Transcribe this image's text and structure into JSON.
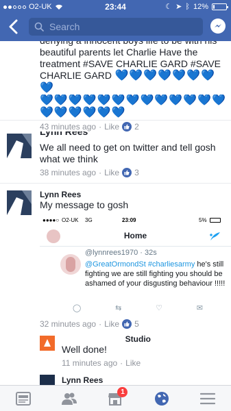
{
  "status_bar": {
    "carrier": "O2-UK",
    "time": "23:44",
    "battery_percent": "12%",
    "battery_level": 0.12
  },
  "search": {
    "placeholder": "Search"
  },
  "comments": [
    {
      "partial_top_text": "denying a innocent boys life to be with his",
      "text_lines": [
        "beautiful parents let Charlie  Have the",
        "treatment #SAVE CHARLIE GARD #SAVE",
        "CHARLIE GARD"
      ],
      "hearts_line1": "💙💙💙💙💙💙💙💙",
      "hearts_line2": "💙💙💙💙💙💙💙💙💙💙💙💙💙💙",
      "hearts_line3": "💙💙💙💙💙💙",
      "time": "43 minutes ago",
      "like_label": "Like",
      "reactions": "2"
    },
    {
      "name_partial": "Lynn Rees",
      "text_line1": "We all need to get on twitter and tell gosh",
      "text_line2": "what we think",
      "time": "38 minutes ago",
      "like_label": "Like",
      "reactions": "3"
    },
    {
      "name": "Lynn Rees",
      "text": "My message to gosh",
      "time": "32 minutes ago",
      "like_label": "Like",
      "reactions": "5"
    }
  ],
  "embedded_screenshot": {
    "carrier": "O2-UK",
    "network": "3G",
    "time": "23:09",
    "battery": "5%",
    "title": "Home",
    "tweet_handle": "@lynnrees1970 · 32s",
    "tweet_mention": "@GreatOrmondSt",
    "tweet_hashtag": "#charliesarmy",
    "tweet_rest_line1": "he's still",
    "tweet_line2": "fighting we are still fighting you should",
    "tweet_line3": "be ashamed of your disgusting",
    "tweet_line4": "behaviour !!!!!"
  },
  "reply": {
    "name_partial": "Studio",
    "text": "Well done!",
    "time": "11 minutes ago",
    "like_label": "Like"
  },
  "next_partial_name": "Lynn Rees",
  "tabs": {
    "marketplace_badge": "1"
  },
  "colors": {
    "facebook_blue": "#4267b2",
    "heart_blue": "#1877f2",
    "badge_red": "#fa3e3e"
  }
}
